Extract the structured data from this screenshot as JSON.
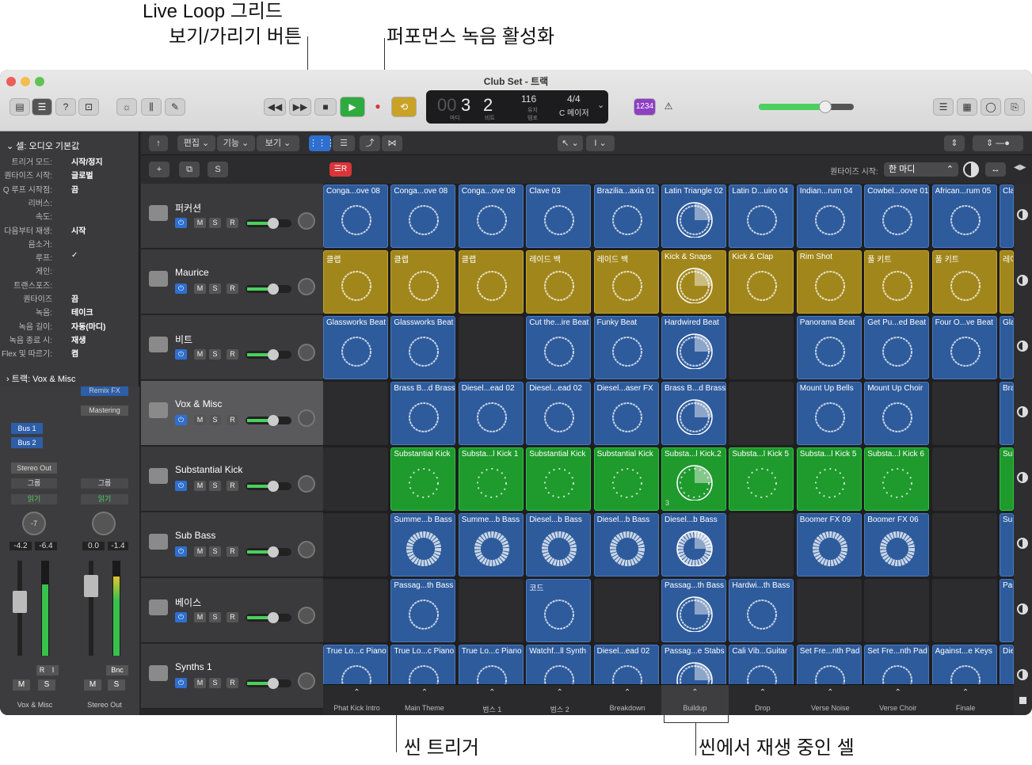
{
  "callouts": {
    "live_loop_line1": "Live Loop 그리드",
    "live_loop_line2": "보기/가리기 버튼",
    "perf_record": "퍼포먼스 녹음 활성화",
    "scene_trigger": "씬 트리거",
    "playing_cells": "씬에서 재생 중인 셀"
  },
  "window": {
    "title": "Club Set - 트랙"
  },
  "transport": {
    "bar": "3",
    "beat": "2",
    "bar_prefix": "00",
    "bar_label": "마디",
    "beat_label": "비트",
    "tempo": "116",
    "tempo_label1": "유지",
    "tempo_label2": "템포",
    "sig": "4/4",
    "key": "C 메이저",
    "count_in": "1234"
  },
  "toolbar2": {
    "edit": "편집",
    "function": "기능",
    "view": "보기"
  },
  "header": {
    "quantize_label": "퀀타이즈 시작:",
    "quantize_value": "한 마디",
    "add": "+",
    "s": "S"
  },
  "inspector": {
    "section": "셀: 오디오 기본값",
    "rows": [
      {
        "k": "트리거 모드:",
        "v": "시작/정지"
      },
      {
        "k": "퀀타이즈 시작:",
        "v": "글로벌"
      },
      {
        "k": "Q 루프 시작점:",
        "v": "끔"
      },
      {
        "k": "리버스:",
        "v": ""
      },
      {
        "k": "속도:",
        "v": ""
      },
      {
        "k": "다음부터 재생:",
        "v": "시작"
      },
      {
        "k": "음소거:",
        "v": ""
      },
      {
        "k": "루프:",
        "v": "✓"
      },
      {
        "k": "게인:",
        "v": ""
      },
      {
        "k": "트랜스포즈:",
        "v": ""
      },
      {
        "k": "퀀타이즈",
        "v": "끔"
      },
      {
        "k": "녹음:",
        "v": "테이크"
      },
      {
        "k": "녹음 길이:",
        "v": "자동(마디)"
      },
      {
        "k": "녹음 종료 시:",
        "v": "재생"
      },
      {
        "k": "Flex 및 따르기:",
        "v": "켬"
      }
    ],
    "track_section": "트랙:  Vox & Misc"
  },
  "mixer": {
    "remix": "Remix FX",
    "mastering": "Mastering",
    "bus1": "Bus 1",
    "bus2": "Bus 2",
    "stereo_out": "Stereo Out",
    "group": "그룹",
    "read": "읽기",
    "pan_val": "-7",
    "vol1": "-4.2",
    "peak1": "-6.4",
    "vol2": "0.0",
    "peak2": "-1.4",
    "r": "R",
    "i": "I",
    "bnc": "Bnc",
    "m": "M",
    "s": "S",
    "ch1": "Vox & Misc",
    "ch2": "Stereo Out"
  },
  "tracks": [
    {
      "name": "퍼커션"
    },
    {
      "name": "Maurice"
    },
    {
      "name": "비트"
    },
    {
      "name": "Vox & Misc"
    },
    {
      "name": "Substantial Kick"
    },
    {
      "name": "Sub Bass"
    },
    {
      "name": "베이스"
    },
    {
      "name": "Synths 1"
    }
  ],
  "track_buttons": {
    "m": "M",
    "s": "S",
    "r": "R"
  },
  "rows": [
    {
      "color": "blue",
      "cells": [
        "Conga...ove 08",
        "Conga...ove 08",
        "Conga...ove 08",
        "Clave 03",
        "Brazilia...axia 01",
        "Latin Triangle 02",
        "Latin D...uiro 04",
        "Indian...rum 04",
        "Cowbel...oove 01",
        "African...rum 05",
        "Cla"
      ]
    },
    {
      "color": "gold",
      "cells": [
        "클랩",
        "클랩",
        "클랩",
        "레이드 백",
        "레이드 백",
        "Kick & Snaps",
        "Kick & Clap",
        "Rim Shot",
        "풀 키트",
        "풀 키트",
        "레이"
      ]
    },
    {
      "color": "blue",
      "cells": [
        "Glassworks Beat",
        "Glassworks Beat",
        "",
        "Cut the...ire Beat",
        "Funky Beat",
        "Hardwired Beat",
        "",
        "Panorama Beat",
        "Get Pu...ed Beat",
        "Four O...ve Beat",
        "Gla"
      ]
    },
    {
      "color": "blue",
      "cells": [
        "",
        "Brass B...d Brass",
        "Diesel...ead 02",
        "Diesel...ead 02",
        "Diesel...aser FX",
        "Brass B...d Brass",
        "",
        "Mount Up Bells",
        "Mount Up Choir",
        "",
        "Bra"
      ]
    },
    {
      "color": "green",
      "cells": [
        "",
        "Substantial Kick",
        "Substa...l Kick 1",
        "Substantial Kick",
        "Substantial Kick",
        "Substa...l Kick.2",
        "Substa...l Kick 5",
        "Substa...l Kick 5",
        "Substa...l Kick 6",
        "",
        "Sul"
      ]
    },
    {
      "color": "blue",
      "cells": [
        "",
        "Summe...b Bass",
        "Summe...b Bass",
        "Diesel...b Bass",
        "Diesel...b Bass",
        "Diesel...b Bass",
        "",
        "Boomer FX 09",
        "Boomer FX 06",
        "",
        "Sur"
      ]
    },
    {
      "color": "blue",
      "cells": [
        "",
        "Passag...th Bass",
        "",
        "코드",
        "",
        "Passag...th Bass",
        "Hardwi...th Bass",
        "",
        "",
        "",
        "Pas"
      ]
    },
    {
      "color": "blue",
      "cells": [
        "True Lo...c Piano",
        "True Lo...c Piano",
        "True Lo...c Piano",
        "Watchf...ll Synth",
        "Diesel...ead 02",
        "Passag...e Stabs",
        "Cali Vib...Guitar",
        "Set Fre...nth Pad",
        "Set Fre...nth Pad",
        "Against...e Keys",
        "Die"
      ]
    }
  ],
  "cell_number": "3",
  "scenes": [
    "Phat Kick Intro",
    "Main Theme",
    "범스 1",
    "범스 2",
    "Breakdown",
    "Buildup",
    "Drop",
    "Verse Noise",
    "Verse Choir",
    "Finale"
  ],
  "colors": {
    "blue": "#2e5b9c",
    "gold": "#a1861b",
    "green": "#1f9a2d",
    "record": "#d9343a",
    "play": "#2eaa3f",
    "cycle": "#c9a227"
  }
}
